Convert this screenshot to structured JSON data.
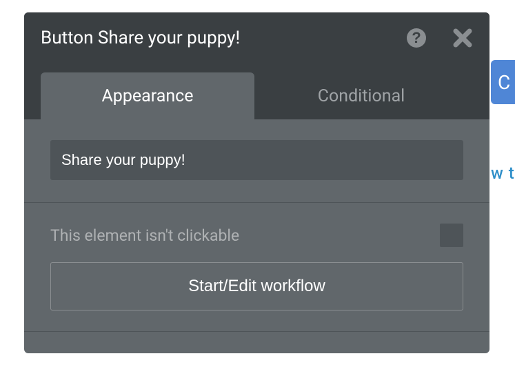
{
  "titlebar": {
    "title": "Button Share your puppy!"
  },
  "tabs": {
    "items": [
      {
        "label": "Appearance"
      },
      {
        "label": "Conditional"
      }
    ]
  },
  "content": {
    "text_value": "Share your puppy!",
    "not_clickable_label": "This element isn't clickable",
    "workflow_button": "Start/Edit workflow"
  },
  "background": {
    "pill_letter": "C",
    "link_fragment": "w t"
  }
}
